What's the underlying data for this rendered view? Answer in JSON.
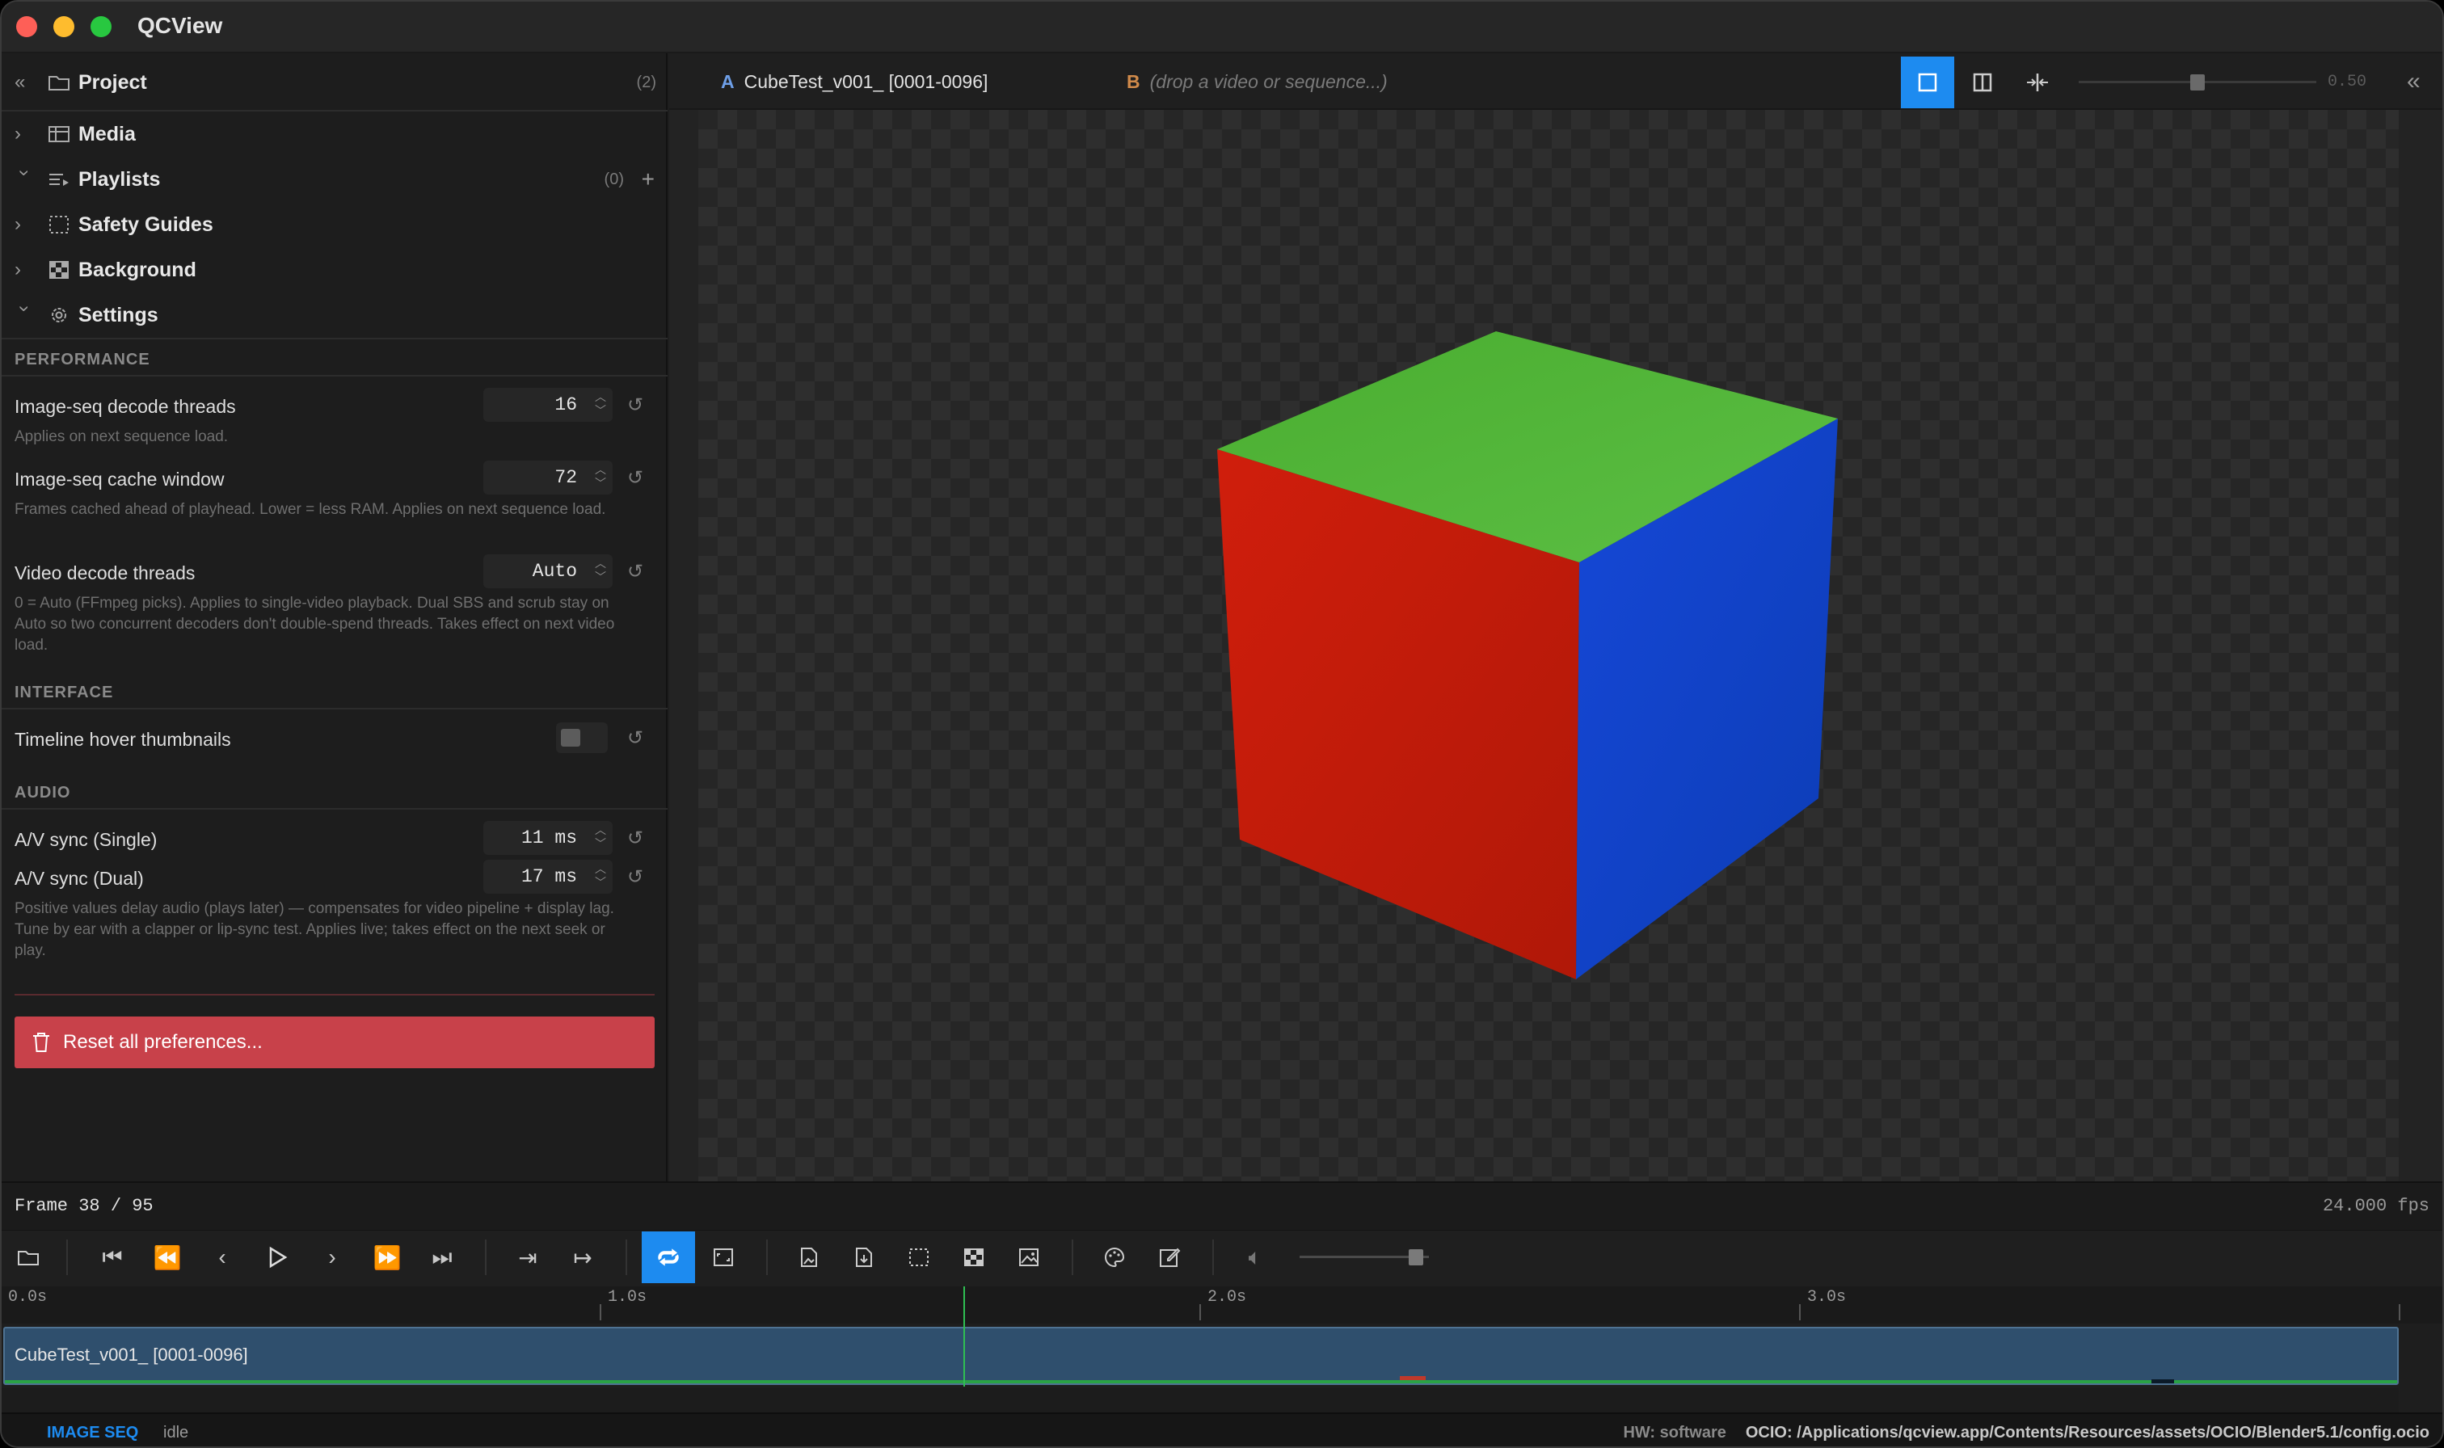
{
  "app": {
    "title": "QCView"
  },
  "sidebar": {
    "project": {
      "label": "Project",
      "count": "(2)"
    },
    "media": {
      "label": "Media"
    },
    "playlists": {
      "label": "Playlists",
      "count": "(0)"
    },
    "safety_guides": {
      "label": "Safety Guides"
    },
    "background": {
      "label": "Background"
    },
    "settings": {
      "label": "Settings"
    }
  },
  "settings": {
    "performance_header": "PERFORMANCE",
    "decode_threads": {
      "label": "Image-seq decode threads",
      "value": "16",
      "desc": "Applies on next sequence load."
    },
    "cache_window": {
      "label": "Image-seq cache window",
      "value": "72",
      "desc": "Frames cached ahead of playhead. Lower = less RAM. Applies on next sequence load."
    },
    "video_threads": {
      "label": "Video decode threads",
      "value": "Auto",
      "desc": "0 = Auto (FFmpeg picks). Applies to single-video playback. Dual SBS and scrub stay on Auto so two concurrent decoders don't double-spend threads. Takes effect on next video load."
    },
    "interface_header": "INTERFACE",
    "hover_thumbnails": {
      "label": "Timeline hover thumbnails",
      "enabled": false
    },
    "audio_header": "AUDIO",
    "av_single": {
      "label": "A/V sync (Single)",
      "value": "11 ms"
    },
    "av_dual": {
      "label": "A/V sync (Dual)",
      "value": "17 ms",
      "desc": "Positive values delay audio (plays later) — compensates for video pipeline + display lag. Tune by ear with a clapper or lip-sync test. Applies live; takes effect on the next seek or play."
    },
    "reset_label": "Reset all preferences..."
  },
  "viewer": {
    "slot_a": {
      "letter": "A",
      "name": "CubeTest_v001_ [0001-0096]"
    },
    "slot_b": {
      "letter": "B",
      "placeholder": "(drop a video or sequence...)"
    },
    "wipe_value": "0.50",
    "wipe_level": 0.5
  },
  "playback": {
    "frame_label": "Frame 38 / 95",
    "fps": "24.000 fps",
    "volume_level": 0.95
  },
  "timeline": {
    "ticks": [
      "0.0s",
      "1.0s",
      "2.0s",
      "3.0s"
    ],
    "clip_name": "CubeTest_v001_ [0001-0096]",
    "playhead_frame": 38,
    "total_frames": 95
  },
  "footer": {
    "mode": "IMAGE SEQ",
    "state": "idle",
    "hw": "HW: software",
    "ocio": "OCIO: /Applications/qcview.app/Contents/Resources/assets/OCIO/Blender5.1/config.ocio"
  },
  "colors": {
    "accent": "#1d8bf0",
    "danger": "#c8414a",
    "cube_top": "#52b63a",
    "cube_left": "#c01c0c",
    "cube_right": "#0f44c8"
  }
}
